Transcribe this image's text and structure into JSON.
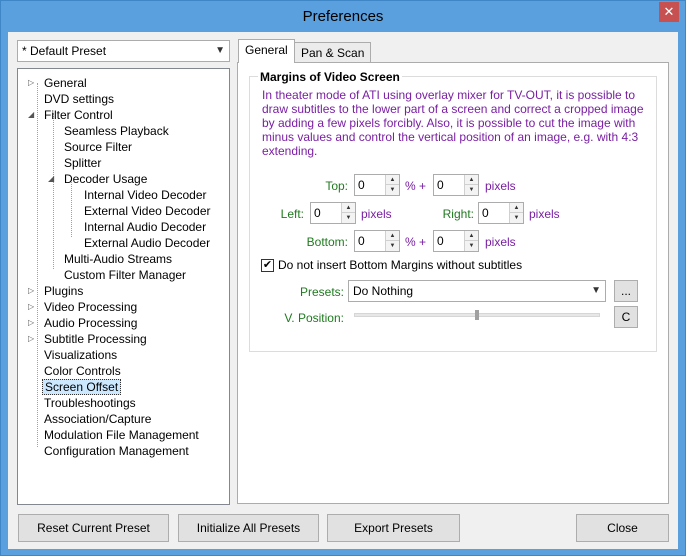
{
  "window": {
    "title": "Preferences",
    "close_glyph": "✕"
  },
  "preset_dropdown": {
    "value": "* Default Preset"
  },
  "tree": {
    "items": [
      {
        "label": "General",
        "expander": "▷"
      },
      {
        "label": "DVD settings",
        "expander": ""
      },
      {
        "label": "Filter Control",
        "expander": "◢"
      },
      {
        "label": "Seamless Playback",
        "expander": ""
      },
      {
        "label": "Source Filter",
        "expander": ""
      },
      {
        "label": "Splitter",
        "expander": ""
      },
      {
        "label": "Decoder Usage",
        "expander": "◢"
      },
      {
        "label": "Internal Video Decoder",
        "expander": ""
      },
      {
        "label": "External Video Decoder",
        "expander": ""
      },
      {
        "label": "Internal Audio Decoder",
        "expander": ""
      },
      {
        "label": "External Audio Decoder",
        "expander": ""
      },
      {
        "label": "Multi-Audio Streams",
        "expander": ""
      },
      {
        "label": "Custom Filter Manager",
        "expander": ""
      },
      {
        "label": "Plugins",
        "expander": "▷"
      },
      {
        "label": "Video Processing",
        "expander": "▷"
      },
      {
        "label": "Audio Processing",
        "expander": "▷"
      },
      {
        "label": "Subtitle Processing",
        "expander": "▷"
      },
      {
        "label": "Visualizations",
        "expander": ""
      },
      {
        "label": "Color Controls",
        "expander": ""
      },
      {
        "label": "Screen Offset",
        "expander": ""
      },
      {
        "label": "Troubleshootings",
        "expander": ""
      },
      {
        "label": "Association/Capture",
        "expander": ""
      },
      {
        "label": "Modulation File Management",
        "expander": ""
      },
      {
        "label": "Configuration Management",
        "expander": ""
      }
    ],
    "selected": "Screen Offset"
  },
  "tabs": [
    {
      "label": "General",
      "active": true
    },
    {
      "label": "Pan & Scan",
      "active": false
    }
  ],
  "margins_group": {
    "title": "Margins of Video Screen",
    "description": "In theater mode of ATI using overlay mixer for TV-OUT, it is possible to draw subtitles to the lower part of a screen and correct a cropped image by adding a few pixels forcibly. Also, it is possible to cut the image with minus values and control the vertical position of an image, e.g. with 4:3 extending.",
    "top": {
      "label": "Top:",
      "percent": "0",
      "pixels": "0"
    },
    "left": {
      "label": "Left:",
      "pixels": "0"
    },
    "right": {
      "label": "Right:",
      "pixels": "0"
    },
    "bottom": {
      "label": "Bottom:",
      "percent": "0",
      "pixels": "0"
    },
    "percent_plus": "% +",
    "pixels_unit": "pixels",
    "checkbox": {
      "label": "Do not insert Bottom Margins without subtitles",
      "checked": true,
      "check_glyph": "✔"
    },
    "presets": {
      "label": "Presets:",
      "value": "Do Nothing",
      "more_label": "..."
    },
    "vposition": {
      "label": "V. Position:",
      "value": 0.5,
      "reset_label": "C"
    }
  },
  "bottom_buttons": {
    "reset": "Reset Current Preset",
    "initialize": "Initialize All Presets",
    "export": "Export Presets",
    "close": "Close"
  },
  "icons": {
    "dropdown": "chevron-down-icon",
    "spin_up": "▲",
    "spin_down": "▼"
  }
}
